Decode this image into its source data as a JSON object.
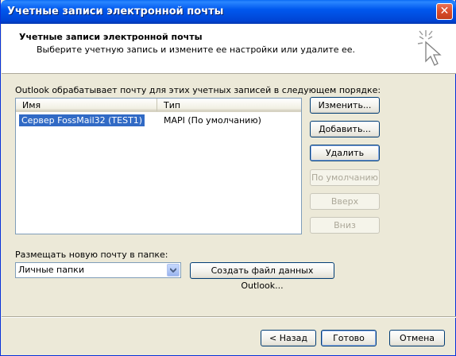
{
  "window": {
    "title": "Учетные записи электронной почты",
    "close_glyph": "✕"
  },
  "header": {
    "title": "Учетные записи электронной почты",
    "subtitle": "Выберите учетную запись и измените ее настройки или удалите ее.",
    "icon": "wizard-cursor-icon"
  },
  "accounts": {
    "label": "Outlook обрабатывает почту для этих учетных записей в следующем порядке:",
    "columns": [
      "Имя",
      "Тип"
    ],
    "rows": [
      {
        "name": "Сервер FossMail32 (TEST1)",
        "type": "MAPI (По умолчанию)",
        "selected": true
      }
    ]
  },
  "side_buttons": {
    "change": "Изменить...",
    "add": "Добавить...",
    "remove": "Удалить",
    "set_default": "По умолчанию",
    "move_up": "Вверх",
    "move_down": "Вниз"
  },
  "delivery": {
    "label": "Размещать новую почту в папке:",
    "selected_folder": "Личные папки",
    "create_button": "Создать файл данных Outlook..."
  },
  "footer": {
    "back": "< Назад",
    "finish": "Готово",
    "cancel": "Отмена"
  },
  "colors": {
    "titlebar": "#0058EE",
    "selection": "#316AC5",
    "dialog_bg": "#ECE9D8"
  }
}
